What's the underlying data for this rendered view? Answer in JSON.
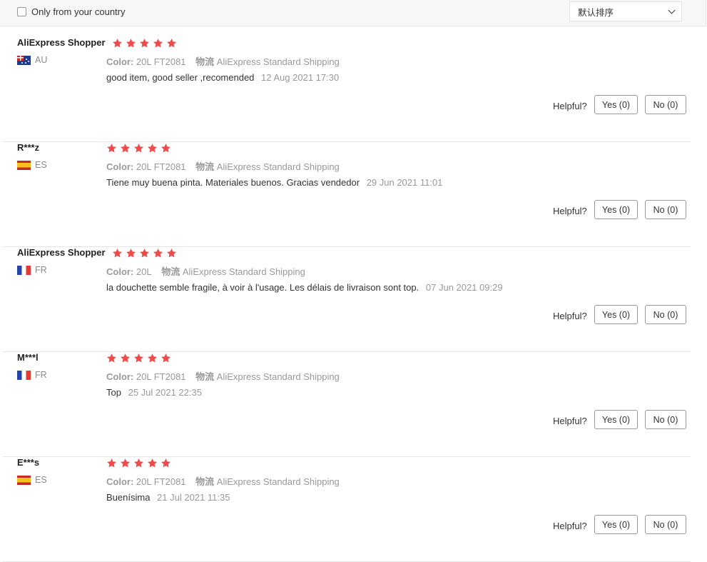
{
  "filter": {
    "label": "Only from your country",
    "checked": false
  },
  "sort": {
    "value": "默认排序"
  },
  "helpful_label": "Helpful?",
  "star_color": "#f04b4b",
  "reviews": [
    {
      "author": "AliExpress Shopper",
      "country": "AU",
      "flag": "au",
      "rating": 5,
      "color_label": "Color:",
      "color_value": "20L FT2081",
      "shipping_label": "物流",
      "shipping_value": "AliExpress Standard Shipping",
      "text": "good item, good seller ,recomended",
      "date": "12 Aug 2021 17:30",
      "yes": "Yes (0)",
      "no": "No (0)"
    },
    {
      "author": "R***z",
      "country": "ES",
      "flag": "es",
      "rating": 5,
      "color_label": "Color:",
      "color_value": "20L FT2081",
      "shipping_label": "物流",
      "shipping_value": "AliExpress Standard Shipping",
      "text": "Tiene muy buena pinta. Materiales buenos. Gracias vendedor",
      "date": "29 Jun 2021 11:01",
      "yes": "Yes (0)",
      "no": "No (0)"
    },
    {
      "author": "AliExpress Shopper",
      "country": "FR",
      "flag": "fr",
      "rating": 5,
      "color_label": "Color:",
      "color_value": "20L",
      "shipping_label": "物流",
      "shipping_value": "AliExpress Standard Shipping",
      "text": "la douchette semble fragile, à voir à l'usage. Les délais de livraison sont top.",
      "date": "07 Jun 2021 09:29",
      "yes": "Yes (0)",
      "no": "No (0)"
    },
    {
      "author": "M***l",
      "country": "FR",
      "flag": "fr",
      "rating": 5,
      "color_label": "Color:",
      "color_value": "20L FT2081",
      "shipping_label": "物流",
      "shipping_value": "AliExpress Standard Shipping",
      "text": "Top",
      "date": "25 Jul 2021 22:35",
      "yes": "Yes (0)",
      "no": "No (0)"
    },
    {
      "author": "E***s",
      "country": "ES",
      "flag": "es",
      "rating": 5,
      "color_label": "Color:",
      "color_value": "20L FT2081",
      "shipping_label": "物流",
      "shipping_value": "AliExpress Standard Shipping",
      "text": "Buenísima",
      "date": "21 Jul 2021 11:35",
      "yes": "Yes (0)",
      "no": "No (0)"
    }
  ]
}
